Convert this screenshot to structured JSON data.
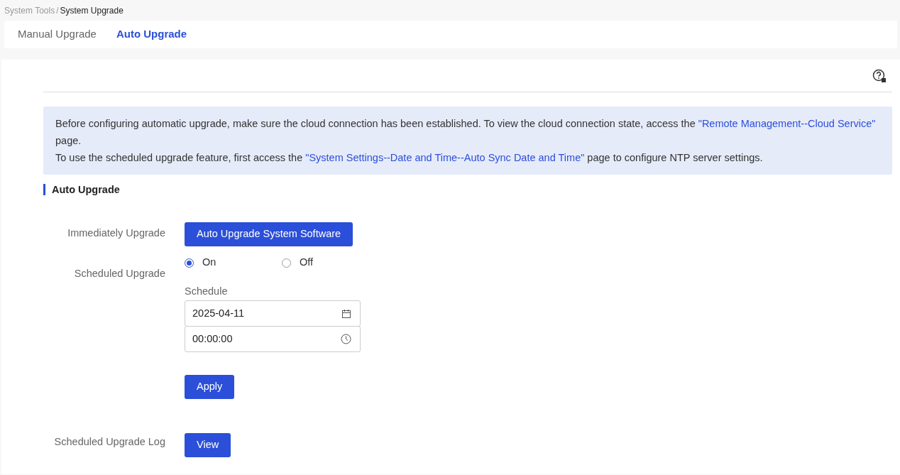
{
  "breadcrumb_separator": "/",
  "breadcrumb": [
    {
      "label": "System Tools",
      "current": false
    },
    {
      "label": "System Upgrade",
      "current": true
    }
  ],
  "tabs": [
    {
      "label": "Manual Upgrade",
      "selected": false
    },
    {
      "label": "Auto Upgrade",
      "selected": true
    }
  ],
  "notice": [
    [
      {
        "kind": "text",
        "text": "Before configuring automatic upgrade, make sure the cloud connection has been established. To view the cloud connection state, access the "
      },
      {
        "kind": "link",
        "text": "\"Remote Management--Cloud Service\""
      },
      {
        "kind": "text",
        "text": " page."
      }
    ],
    [
      {
        "kind": "text",
        "text": "To use the scheduled upgrade feature, first access the "
      },
      {
        "kind": "link",
        "text": "\"System Settings--Date and Time--Auto Sync Date and Time\""
      },
      {
        "kind": "text",
        "text": " page to configure NTP server settings."
      }
    ]
  ],
  "section_title": "Auto Upgrade",
  "immediately_upgrade": {
    "label": "Immediately Upgrade",
    "button": "Auto Upgrade System Software"
  },
  "scheduled_upgrade": {
    "label": "Scheduled Upgrade",
    "options": [
      {
        "label": "On",
        "selected": true
      },
      {
        "label": "Off",
        "selected": false
      }
    ],
    "schedule_label": "Schedule",
    "date": "2025-04-11",
    "time": "00:00:00",
    "apply": "Apply"
  },
  "scheduled_upgrade_log": {
    "label": "Scheduled Upgrade Log",
    "button": "View"
  }
}
